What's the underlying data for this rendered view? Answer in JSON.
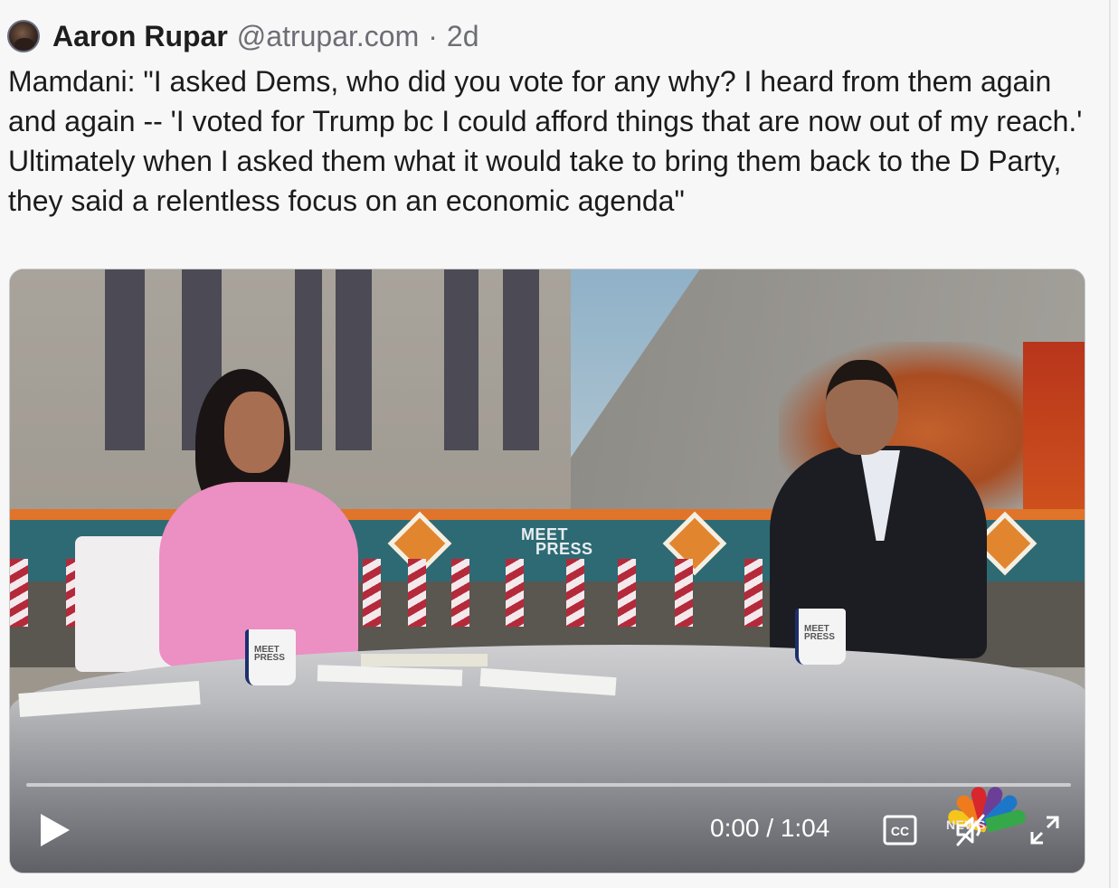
{
  "post": {
    "author_name": "Aaron Rupar",
    "author_handle": "@atrupar.com",
    "separator": "·",
    "age": "2d",
    "text": "Mamdani: \"I asked Dems, who did you vote for any why? I heard from them again and again -- 'I voted for Trump bc I could afford things that are now out of my reach.' Ultimately when I asked them what it would take to bring them back to the D Party, they said a relentless focus on an economic agenda\""
  },
  "video": {
    "set_logo_line1": "MEET",
    "set_logo_line2": "PRESS",
    "network_label": "NEWS",
    "timecode": "0:00 / 1:04",
    "progress": 0,
    "state": "paused",
    "muted": true,
    "controls": {
      "play_icon": "play-icon",
      "captions_icon": "closed-captions-icon",
      "captions_label": "CC",
      "mute_icon": "volume-muted-icon",
      "fullscreen_icon": "fullscreen-icon"
    }
  },
  "colors": {
    "name": "#1e1e1e",
    "meta": "#6d6d75",
    "host_jacket": "#ec8fc3",
    "banner": "#2e6a74",
    "banner_accent": "#e0742a"
  }
}
